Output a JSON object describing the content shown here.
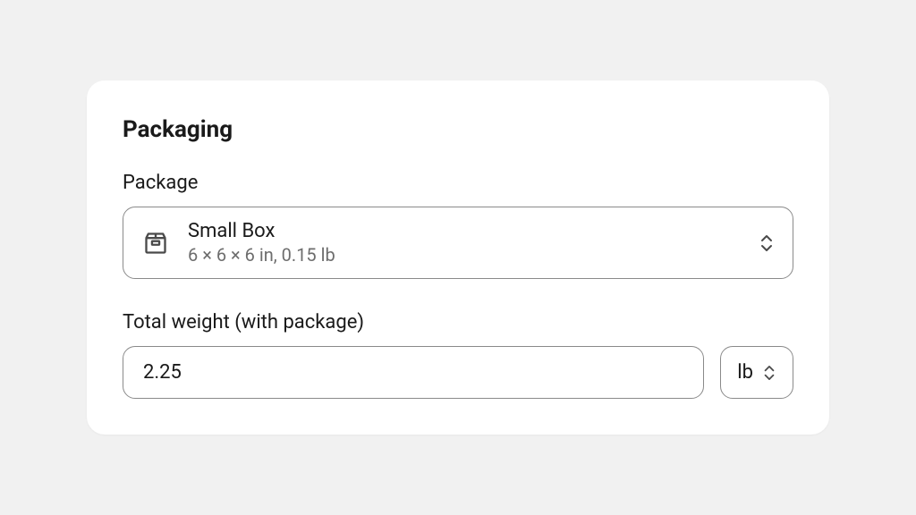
{
  "card": {
    "title": "Packaging"
  },
  "package": {
    "label": "Package",
    "name": "Small Box",
    "dims": "6 × 6 × 6 in, 0.15 lb"
  },
  "weight": {
    "label": "Total weight (with package)",
    "value": "2.25",
    "unit": "lb"
  }
}
